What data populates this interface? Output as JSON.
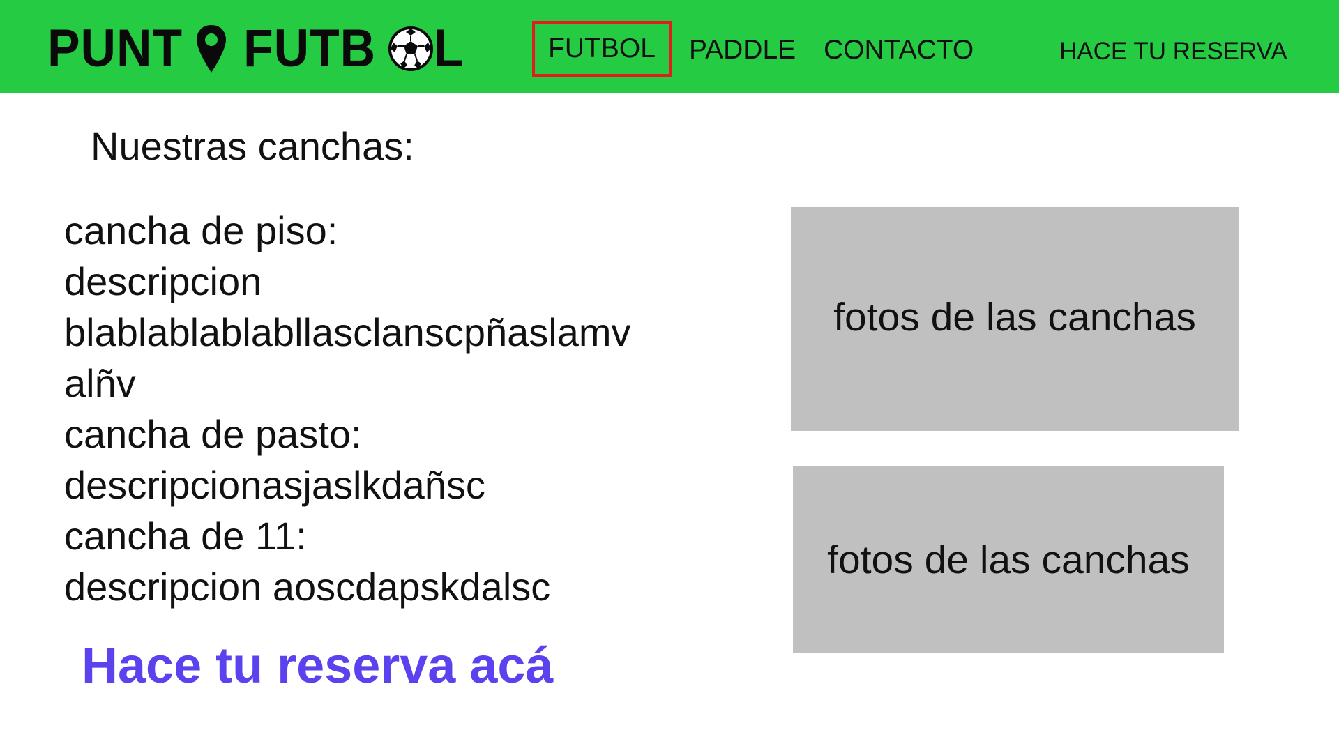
{
  "header": {
    "logo": {
      "text_left": "PUNT",
      "text_right": "FUTB",
      "text_end": "L",
      "alt": "PUNTO FUTBOL"
    },
    "nav": {
      "futbol": "FUTBOL",
      "paddle": "PADDLE",
      "contacto": "CONTACTO",
      "reserva": "HACE TU RESERVA"
    },
    "colors": {
      "background": "#25cc43",
      "active_border": "#e01e1e"
    }
  },
  "main": {
    "title": "Nuestras canchas:",
    "description_lines": [
      "cancha de piso:",
      "descripcion",
      "blablablablabllasclanscpñaslamv",
      "alñv",
      "cancha de pasto:",
      "descripcionasjaslkdañsc",
      "cancha de 11:",
      "descripcion aoscdapskdalsc"
    ],
    "cta": "Hace tu reserva acá",
    "cta_color": "#5a42ee",
    "photos": [
      "fotos de las canchas",
      "fotos de las canchas"
    ]
  }
}
